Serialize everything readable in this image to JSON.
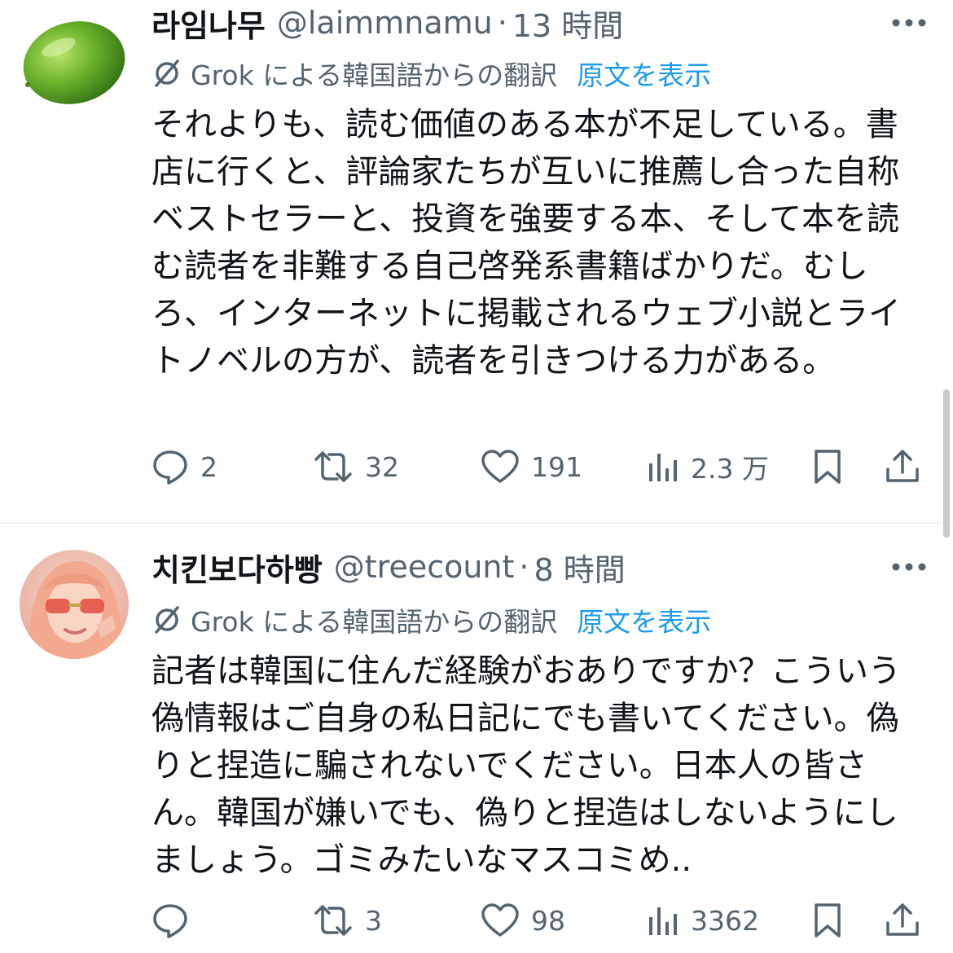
{
  "accent_color": "#1d9bf0",
  "muted_color": "#536471",
  "tweets": [
    {
      "display_name": "라임나무",
      "handle": "@laimmnamu",
      "separator": "·",
      "time": "13 時間",
      "translation_label": "Grok による韓国語からの翻訳",
      "show_original": "原文を表示",
      "body": "それよりも、読む価値のある本が不足している。書店に行くと、評論家たちが互いに推薦し合った自称ベストセラーと、投資を強要する本、そして本を読む読者を非難する自己啓発系書籍ばかりだ。むしろ、インターネットに掲載されるウェブ小説とライトノベルの方が、読者を引きつける力がある。",
      "avatar_icon": "lime-avatar",
      "replies": "2",
      "reposts": "32",
      "likes": "191",
      "views": "2.3 万"
    },
    {
      "display_name": "치킨보다하빵",
      "handle": "@treecount",
      "separator": "·",
      "time": "8 時間",
      "translation_label": "Grok による韓国語からの翻訳",
      "show_original": "原文を表示",
      "body": "記者は韓国に住んだ経験がおありですか？こういう偽情報はご自身の私日記にでも書いてください。偽りと捏造に騙されないでください。日本人の皆さん。韓国が嫌いでも、偽りと捏造はしないようにしましょう。ゴミみたいなマスコミめ..",
      "avatar_icon": "person-with-sunglasses-avatar",
      "replies": "",
      "reposts": "3",
      "likes": "98",
      "views": "3362"
    }
  ]
}
